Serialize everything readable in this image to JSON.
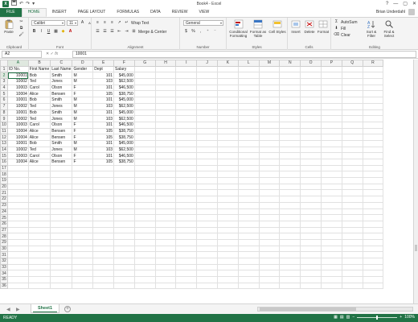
{
  "window": {
    "title": "Book4 - Excel",
    "help_icon": "?",
    "minimize_icon": "—",
    "maximize_icon": "▢",
    "close_icon": "✕",
    "app_icon_label": "X"
  },
  "tabs": [
    {
      "label": "FILE"
    },
    {
      "label": "HOME"
    },
    {
      "label": "INSERT"
    },
    {
      "label": "PAGE LAYOUT"
    },
    {
      "label": "FORMULAS"
    },
    {
      "label": "DATA"
    },
    {
      "label": "REVIEW"
    },
    {
      "label": "VIEW"
    }
  ],
  "user": {
    "name": "Brian Underdahl"
  },
  "ribbon": {
    "clipboard": {
      "paste": "Paste",
      "label": "Clipboard"
    },
    "font": {
      "name": "Calibri",
      "size": "11",
      "label": "Font"
    },
    "alignment": {
      "wrap": "Wrap Text",
      "merge": "Merge & Center",
      "label": "Alignment"
    },
    "number": {
      "format": "General",
      "label": "Number"
    },
    "styles": {
      "conditional": "Conditional Formatting",
      "format_table": "Format as Table",
      "cell_styles": "Cell Styles",
      "label": "Styles"
    },
    "cells": {
      "insert": "Insert",
      "delete": "Delete",
      "format": "Format",
      "label": "Cells"
    },
    "editing": {
      "autosum": "AutoSum",
      "fill": "Fill",
      "clear": "Clear",
      "sort": "Sort & Filter",
      "find": "Find & Select",
      "label": "Editing"
    }
  },
  "formula_bar": {
    "name_box": "A2",
    "value": "10001"
  },
  "grid": {
    "columns": [
      "A",
      "B",
      "C",
      "D",
      "E",
      "F",
      "G",
      "H",
      "I",
      "J",
      "K",
      "L",
      "M",
      "N",
      "O",
      "P",
      "Q",
      "R"
    ],
    "header_row": [
      "ID No.",
      "First Name",
      "Last Name",
      "Gender",
      "Dept",
      "Salary"
    ],
    "rows": [
      [
        "10001",
        "Bob",
        "Smith",
        "M",
        "101",
        "$45,000"
      ],
      [
        "10002",
        "Ted",
        "Jones",
        "M",
        "103",
        "$62,500"
      ],
      [
        "10003",
        "Carol",
        "Olson",
        "F",
        "101",
        "$46,500"
      ],
      [
        "10004",
        "Alice",
        "Bensen",
        "F",
        "105",
        "$38,750"
      ],
      [
        "10001",
        "Bob",
        "Smith",
        "M",
        "101",
        "$45,000"
      ],
      [
        "10002",
        "Ted",
        "Jones",
        "M",
        "103",
        "$62,500"
      ],
      [
        "10001",
        "Bob",
        "Smith",
        "M",
        "101",
        "$45,000"
      ],
      [
        "10002",
        "Ted",
        "Jones",
        "M",
        "103",
        "$62,500"
      ],
      [
        "10003",
        "Carol",
        "Olson",
        "F",
        "101",
        "$46,500"
      ],
      [
        "10004",
        "Alice",
        "Bensen",
        "F",
        "105",
        "$38,750"
      ],
      [
        "10004",
        "Alice",
        "Bensen",
        "F",
        "105",
        "$38,750"
      ],
      [
        "10001",
        "Bob",
        "Smith",
        "M",
        "101",
        "$45,000"
      ],
      [
        "10002",
        "Ted",
        "Jones",
        "M",
        "103",
        "$62,500"
      ],
      [
        "10003",
        "Carol",
        "Olson",
        "F",
        "101",
        "$46,500"
      ],
      [
        "10004",
        "Alice",
        "Bensen",
        "F",
        "105",
        "$38,750"
      ]
    ],
    "total_rows": 36,
    "selected_cell": {
      "row": 2,
      "col": "A"
    }
  },
  "sheets": [
    {
      "name": "Sheet1"
    }
  ],
  "status": {
    "text": "READY",
    "zoom": "100%",
    "zoom_minus": "−",
    "zoom_plus": "+"
  },
  "colors": {
    "accent": "#217346",
    "ribbon_bg": "#f4f4f4"
  }
}
